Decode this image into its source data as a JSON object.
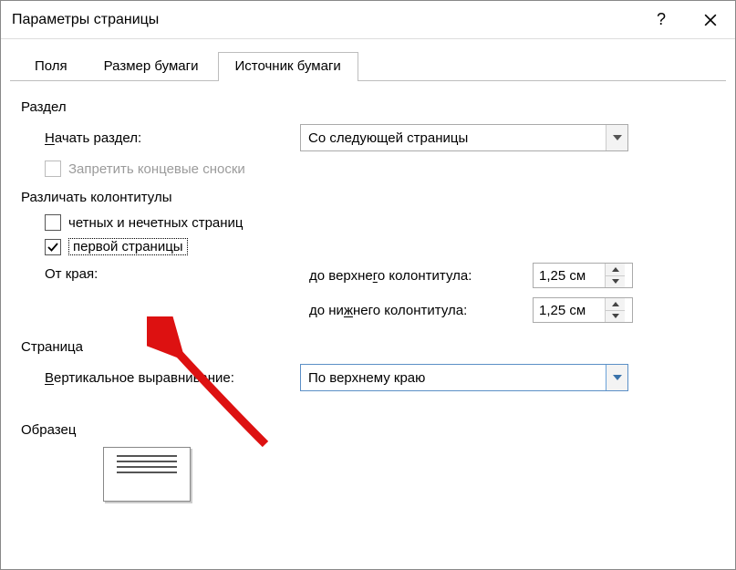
{
  "title": "Параметры страницы",
  "tabs": {
    "fields": "Поля",
    "paper_size": "Размер бумаги",
    "paper_source": "Источник бумаги"
  },
  "section": {
    "label": "Раздел",
    "start_label_pre": "Н",
    "start_label_und": "а",
    "start_label_post": "чать раздел:",
    "start_value": "Со следующей страницы",
    "suppress_endnotes": "Запретить концевые сноски"
  },
  "headers": {
    "label": "Различать колонтитулы",
    "odd_even": "четных и нечетных страниц",
    "first_page": "первой страницы",
    "from_edge": "От края:",
    "to_header_pre": "до верхне",
    "to_header_und": "г",
    "to_header_post": "о колонтитула:",
    "to_footer_pre": "до ни",
    "to_footer_und": "ж",
    "to_footer_post": "него колонтитула:",
    "header_val": "1,25 см",
    "footer_val": "1,25 см"
  },
  "page": {
    "label": "Страница",
    "valign_und": "В",
    "valign_post": "ертикальное выравнивание:",
    "valign_value": "По верхнему краю"
  },
  "preview": {
    "label": "Образец"
  }
}
